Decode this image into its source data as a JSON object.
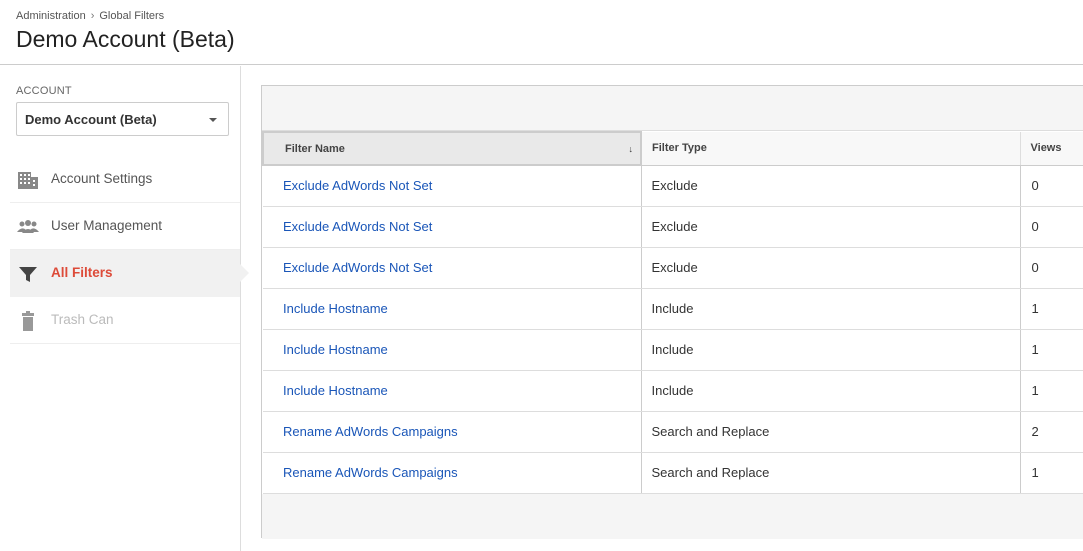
{
  "header": {
    "breadcrumb": [
      "Administration",
      "Global Filters"
    ],
    "breadcrumb_sep": "›",
    "title": "Demo Account (Beta)"
  },
  "sidebar": {
    "account_label": "ACCOUNT",
    "account_selected": "Demo Account (Beta)",
    "items": [
      {
        "label": "Account Settings",
        "icon": "building-icon"
      },
      {
        "label": "User Management",
        "icon": "users-icon"
      },
      {
        "label": "All Filters",
        "icon": "filter-icon",
        "active": true
      },
      {
        "label": "Trash Can",
        "icon": "trash-icon",
        "disabled": true
      }
    ]
  },
  "table": {
    "columns": [
      "Filter Name",
      "Filter Type",
      "Views"
    ],
    "sort_arrow": "↓",
    "rows": [
      {
        "name": "Exclude AdWords Not Set",
        "type": "Exclude",
        "views": "0"
      },
      {
        "name": "Exclude AdWords Not Set",
        "type": "Exclude",
        "views": "0"
      },
      {
        "name": "Exclude AdWords Not Set",
        "type": "Exclude",
        "views": "0"
      },
      {
        "name": "Include Hostname",
        "type": "Include",
        "views": "1"
      },
      {
        "name": "Include Hostname",
        "type": "Include",
        "views": "1"
      },
      {
        "name": "Include Hostname",
        "type": "Include",
        "views": "1"
      },
      {
        "name": "Rename AdWords Campaigns",
        "type": "Search and Replace",
        "views": "2"
      },
      {
        "name": "Rename AdWords Campaigns",
        "type": "Search and Replace",
        "views": "1"
      }
    ]
  },
  "colors": {
    "active_nav": "#dd4b39",
    "link": "#1a56b8"
  }
}
